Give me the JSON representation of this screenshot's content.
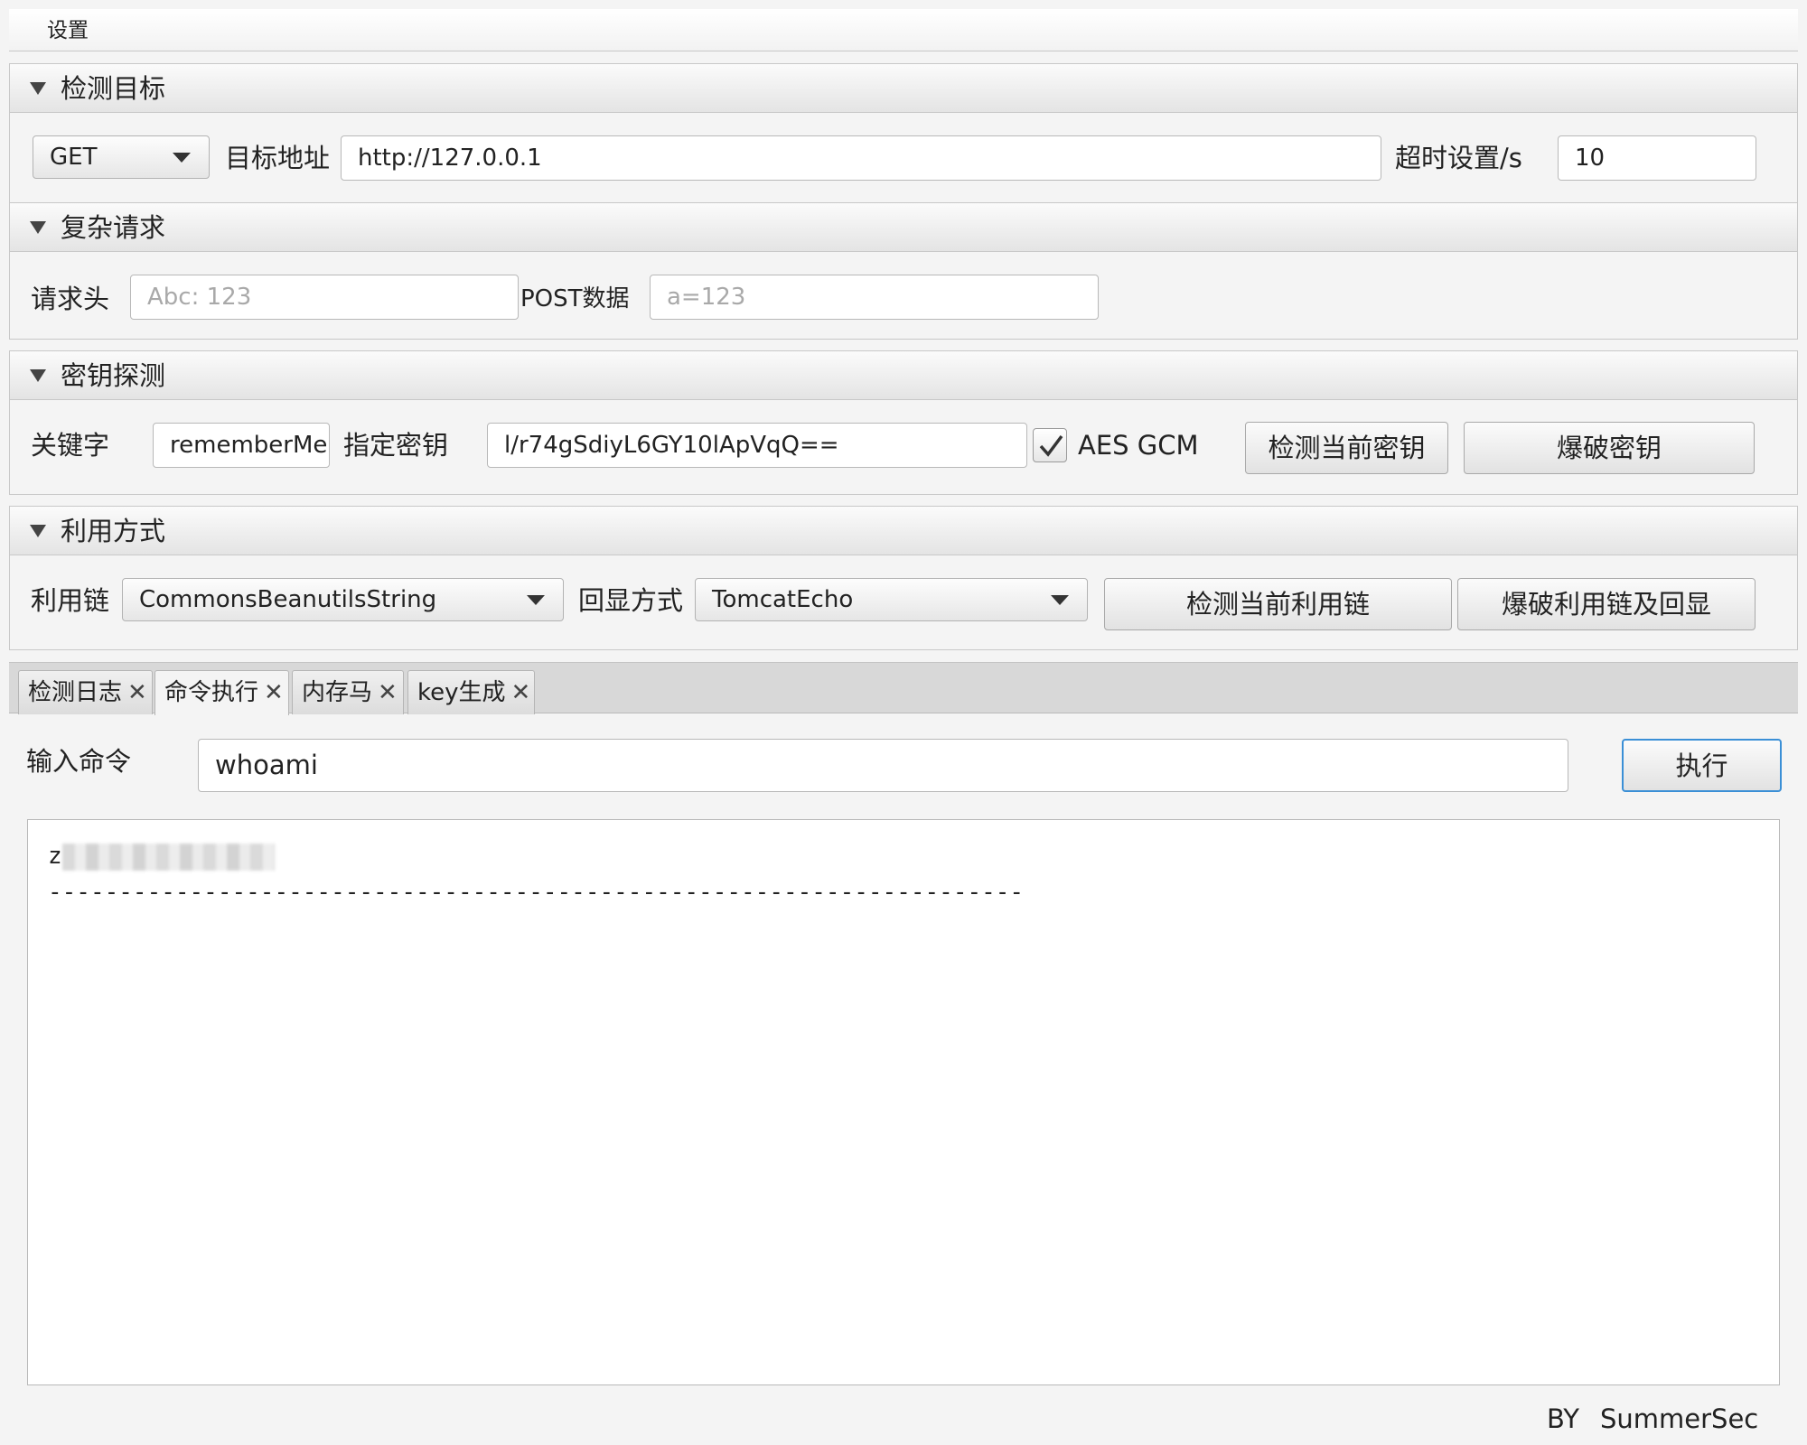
{
  "menu": {
    "settings": "设置"
  },
  "target": {
    "title": "检测目标",
    "method": "GET",
    "url_label": "目标地址",
    "url_value": "http://127.0.0.1",
    "timeout_label": "超时设置/s",
    "timeout_value": "10"
  },
  "complex": {
    "title": "复杂请求",
    "headers_label": "请求头",
    "headers_placeholder": "Abc: 123",
    "post_label": "POST数据",
    "post_placeholder": "a=123"
  },
  "key": {
    "title": "密钥探测",
    "keyword_label": "关键字",
    "keyword_value": "rememberMe",
    "key_label": "指定密钥",
    "key_value": "l/r74gSdiyL6GY10lApVqQ==",
    "gcm_label": "AES GCM",
    "gcm_checked": true,
    "check_button": "检测当前密钥",
    "brute_button": "爆破密钥"
  },
  "exploit": {
    "title": "利用方式",
    "chain_label": "利用链",
    "chain_value": "CommonsBeanutilsString",
    "echo_label": "回显方式",
    "echo_value": "TomcatEcho",
    "check_button": "检测当前利用链",
    "brute_button": "爆破利用链及回显"
  },
  "tabs": [
    {
      "label": "检测日志",
      "active": false
    },
    {
      "label": "命令执行",
      "active": true
    },
    {
      "label": "内存马",
      "active": false
    },
    {
      "label": "key生成",
      "active": false
    }
  ],
  "command": {
    "input_label": "输入命令",
    "input_value": "whoami",
    "execute_button": "执行",
    "output_first_char": "z",
    "output_separator": "---------------------------------------------------------------------"
  },
  "footer": {
    "by": "BY",
    "author": "SummerSec"
  }
}
